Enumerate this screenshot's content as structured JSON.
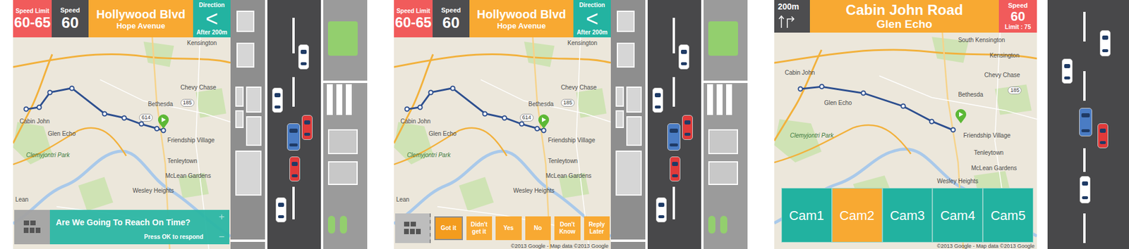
{
  "screens": [
    {
      "kind": "prompt",
      "top": {
        "speed_limit_label": "Speed Limit",
        "speed_limit": "60-65",
        "speed_label": "Speed",
        "speed": "60",
        "street": "Hollywood Blvd",
        "cross_street": "Hope Avenue",
        "direction_label": "Direction",
        "direction_icon": "<",
        "direction_distance": "After 200m"
      },
      "map": {
        "labels": [
          {
            "text": "Kensington",
            "kind": "place"
          },
          {
            "text": "Chevy Chase",
            "kind": "place"
          },
          {
            "text": "Bethesda",
            "kind": "place"
          },
          {
            "text": "Cabin John",
            "kind": "place"
          },
          {
            "text": "Glen Echo",
            "kind": "place"
          },
          {
            "text": "Friendship Village",
            "kind": "place"
          },
          {
            "text": "Tenleytown",
            "kind": "place"
          },
          {
            "text": "Clemyjontri Park",
            "kind": "park"
          },
          {
            "text": "McLean Gardens",
            "kind": "place"
          },
          {
            "text": "Wesley Heights",
            "kind": "place"
          },
          {
            "text": "Lean",
            "kind": "place"
          }
        ],
        "shields": [
          "185",
          "614"
        ]
      },
      "prompt": {
        "question": "Are We Going To Reach On Time?",
        "hint": "Press OK to respond",
        "zoom": [
          "+",
          "−"
        ]
      },
      "road": {
        "cars": [
          {
            "color": "#ffffff"
          },
          {
            "color": "#ffffff"
          },
          {
            "color": "#4a7cc4"
          },
          {
            "color": "#e03a3a"
          },
          {
            "color": "#e03a3a"
          },
          {
            "color": "#ffffff"
          }
        ]
      }
    },
    {
      "kind": "reply",
      "top": {
        "speed_limit_label": "Speed Limit",
        "speed_limit": "60-65",
        "speed_label": "Speed",
        "speed": "60",
        "street": "Hollywood Blvd",
        "cross_street": "Hope Avenue",
        "direction_label": "Direction",
        "direction_icon": "<",
        "direction_distance": "After 200m"
      },
      "map": {
        "labels": [
          {
            "text": "Kensington",
            "kind": "place"
          },
          {
            "text": "Chevy Chase",
            "kind": "place"
          },
          {
            "text": "Bethesda",
            "kind": "place"
          },
          {
            "text": "Cabin John",
            "kind": "place"
          },
          {
            "text": "Glen Echo",
            "kind": "place"
          },
          {
            "text": "Friendship Village",
            "kind": "place"
          },
          {
            "text": "Tenleytown",
            "kind": "place"
          },
          {
            "text": "Clemyjontri Park",
            "kind": "park"
          },
          {
            "text": "McLean Gardens",
            "kind": "place"
          },
          {
            "text": "Wesley Heights",
            "kind": "place"
          },
          {
            "text": "Lean",
            "kind": "place"
          }
        ],
        "shields": [
          "185",
          "614"
        ]
      },
      "replies": [
        {
          "label": "Got it",
          "selected": true
        },
        {
          "label": "Didn't get it",
          "selected": false
        },
        {
          "label": "Yes",
          "selected": false
        },
        {
          "label": "No",
          "selected": false
        },
        {
          "label": "Don't Know",
          "selected": false
        },
        {
          "label": "Reply Later",
          "selected": false
        }
      ],
      "copyright": "©2013 Google - Map data ©2013 Google",
      "road": {
        "cars": [
          {
            "color": "#ffffff"
          },
          {
            "color": "#ffffff"
          },
          {
            "color": "#4a7cc4"
          },
          {
            "color": "#e03a3a"
          },
          {
            "color": "#e03a3a"
          },
          {
            "color": "#ffffff"
          }
        ]
      }
    },
    {
      "kind": "cameras",
      "top": {
        "distance": "200m",
        "street": "Cabin John Road",
        "area": "Glen Echo",
        "speed_label": "Speed",
        "speed": "60",
        "limit": "Limit : 75"
      },
      "map": {
        "labels": [
          {
            "text": "South Kensington",
            "kind": "place"
          },
          {
            "text": "Kensington",
            "kind": "place"
          },
          {
            "text": "Chevy Chase",
            "kind": "place"
          },
          {
            "text": "Bethesda",
            "kind": "place"
          },
          {
            "text": "Cabin John",
            "kind": "place"
          },
          {
            "text": "Glen Echo",
            "kind": "place"
          },
          {
            "text": "Friendship Village",
            "kind": "place"
          },
          {
            "text": "Tenleytown",
            "kind": "place"
          },
          {
            "text": "Clemyjontri Park",
            "kind": "park"
          },
          {
            "text": "McLean Gardens",
            "kind": "place"
          },
          {
            "text": "Wesley Heights",
            "kind": "place"
          }
        ],
        "shields": [
          "185"
        ]
      },
      "cameras": [
        {
          "label": "Cam1",
          "selected": false
        },
        {
          "label": "Cam2",
          "selected": true
        },
        {
          "label": "Cam3",
          "selected": false
        },
        {
          "label": "Cam4",
          "selected": false
        },
        {
          "label": "Cam5",
          "selected": false
        }
      ],
      "copyright": "©2013 Google - Map data ©2013 Google",
      "road": {
        "cars": [
          {
            "color": "#ffffff"
          },
          {
            "color": "#ffffff"
          },
          {
            "color": "#4a7cc4"
          },
          {
            "color": "#e03a3a"
          },
          {
            "color": "#ffffff"
          }
        ]
      }
    }
  ]
}
